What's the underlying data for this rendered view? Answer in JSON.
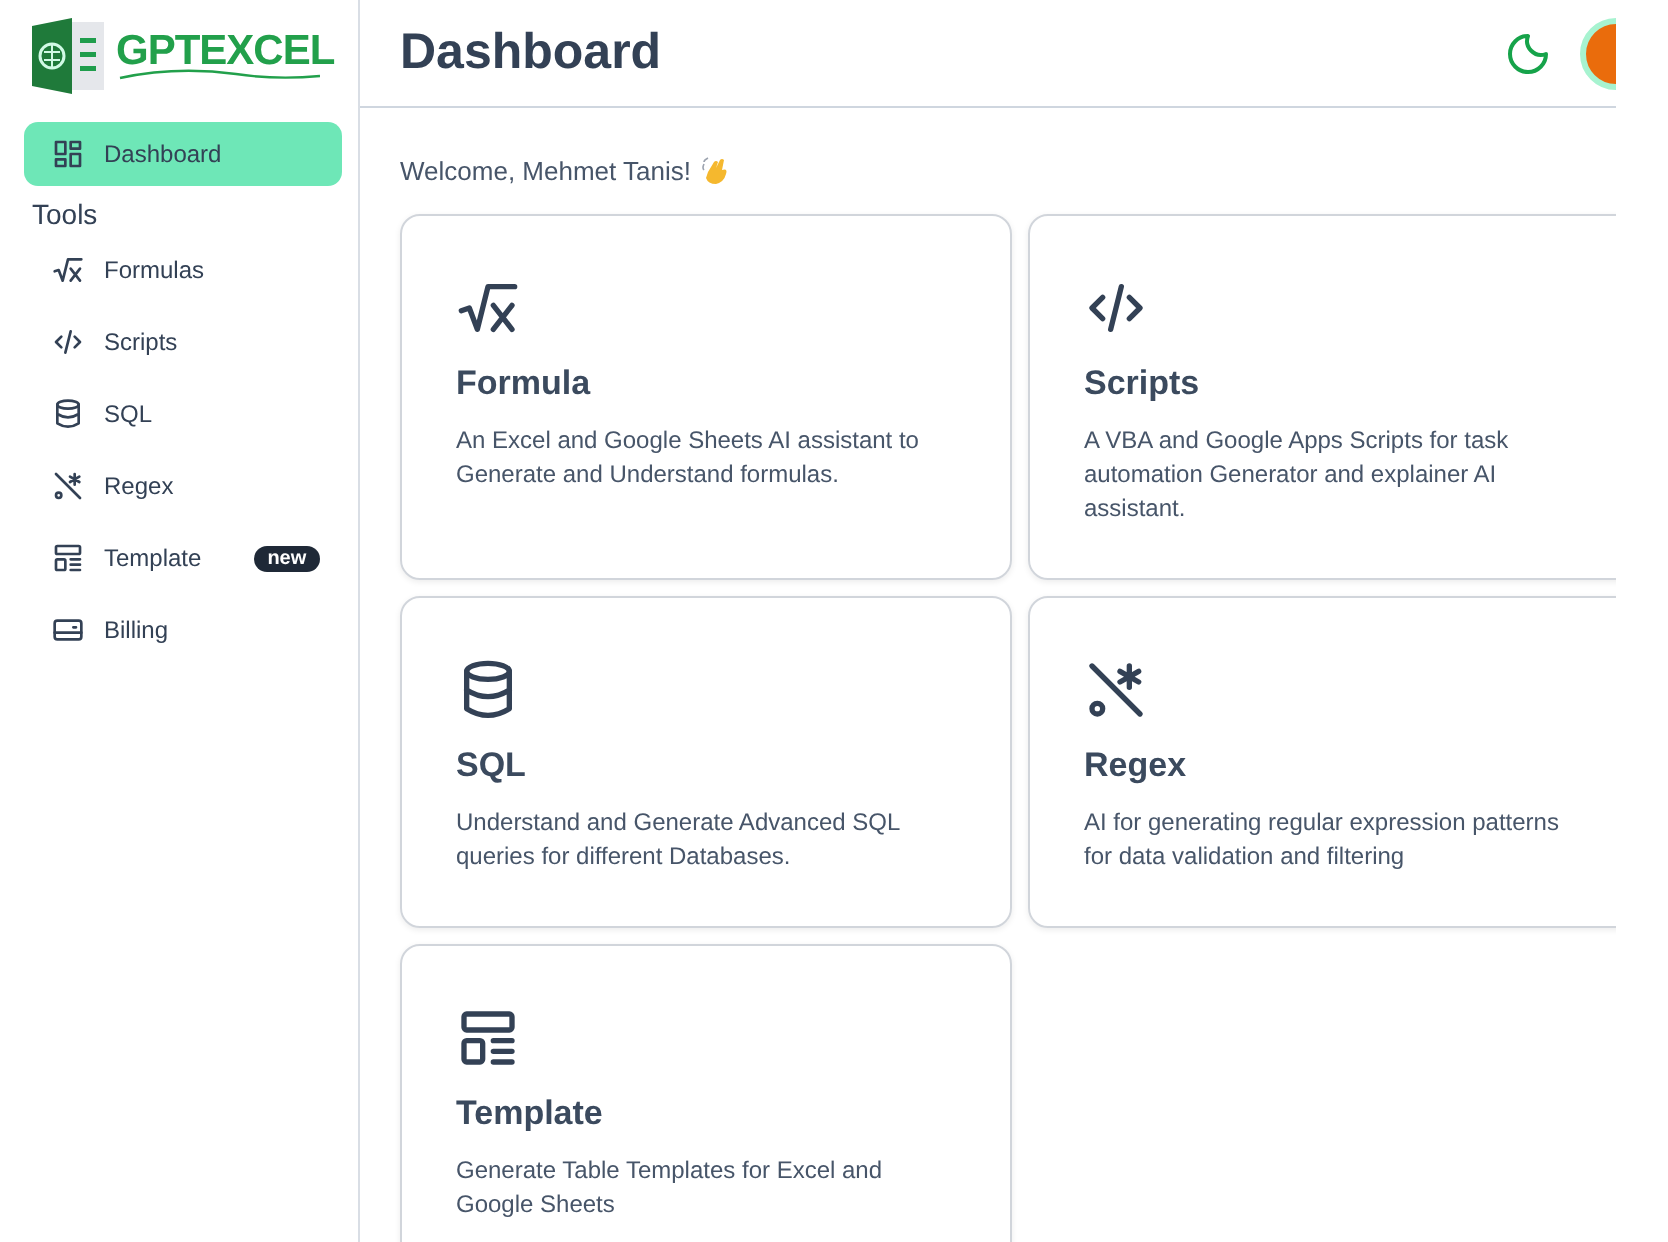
{
  "logo": {
    "text": "GPTEXCEL"
  },
  "sidebar": {
    "items": [
      {
        "label": "Dashboard",
        "kind": "dashboard",
        "selected": true
      }
    ],
    "section_title": "Tools",
    "tools": [
      {
        "label": "Formulas",
        "kind": "sqrt",
        "selected": false
      },
      {
        "label": "Scripts",
        "kind": "code",
        "selected": false
      },
      {
        "label": "SQL",
        "kind": "database",
        "selected": false
      },
      {
        "label": "Regex",
        "kind": "regex",
        "selected": false
      },
      {
        "label": "Template",
        "kind": "template",
        "selected": false,
        "badge": "new"
      },
      {
        "label": "Billing",
        "kind": "card",
        "selected": false
      }
    ]
  },
  "header": {
    "title": "Dashboard"
  },
  "welcome": "Welcome, Mehmet Tanis!",
  "cards": [
    {
      "title": "Formula",
      "kind": "sqrt",
      "description": "An Excel and Google Sheets AI assistant to Generate and Understand formulas."
    },
    {
      "title": "Scripts",
      "kind": "code",
      "description": "A VBA and Google Apps Scripts for task automation Generator and explainer AI assistant."
    },
    {
      "title": "SQL",
      "kind": "database",
      "description": "Understand and Generate Advanced SQL queries for different Databases."
    },
    {
      "title": "Regex",
      "kind": "regex",
      "description": "AI for generating regular expression patterns for data validation and filtering"
    },
    {
      "title": "Template",
      "kind": "template",
      "description": "Generate Table Templates for Excel and Google Sheets"
    }
  ]
}
